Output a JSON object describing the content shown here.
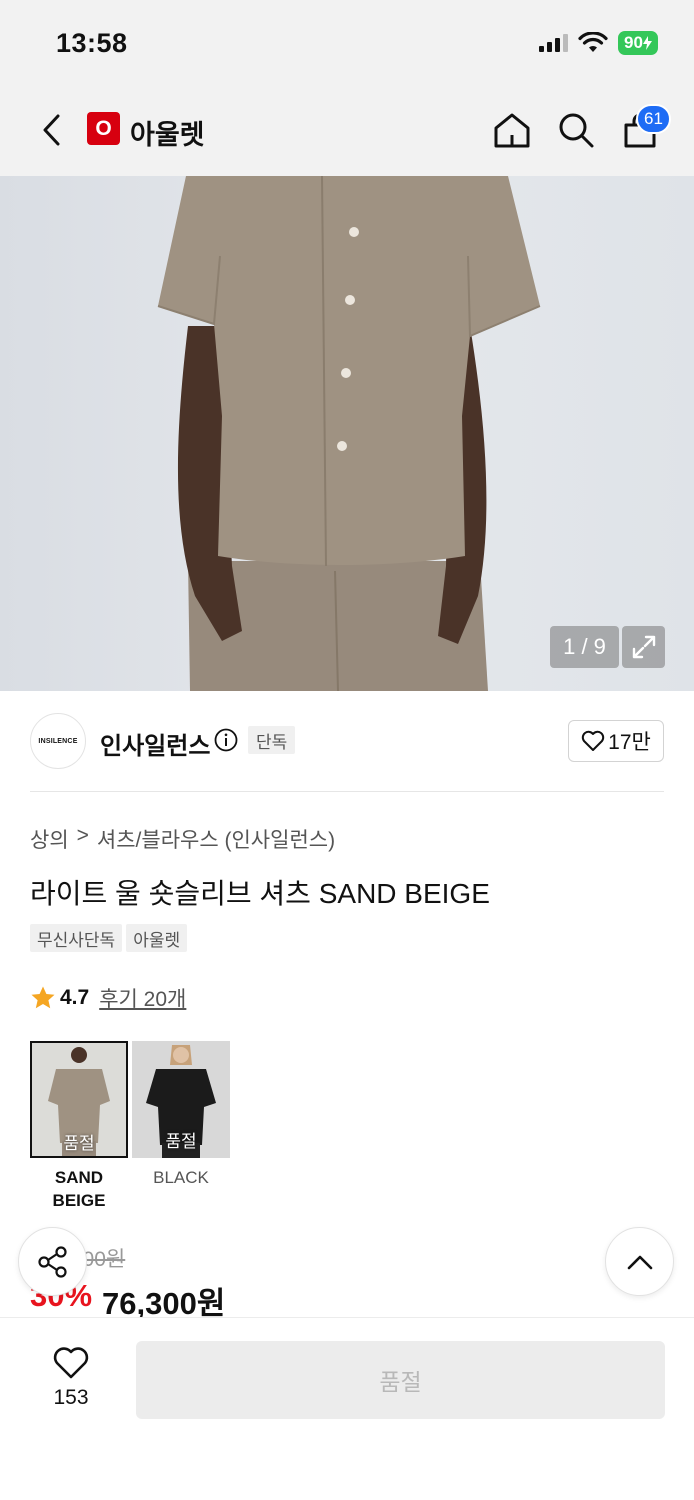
{
  "status_bar": {
    "time": "13:58",
    "battery": "90"
  },
  "nav": {
    "logo_letter": "O",
    "title": "아울렛",
    "cart_count": "61"
  },
  "gallery": {
    "counter": "1 / 9"
  },
  "brand": {
    "logo_text": "INSILENCE",
    "name": "인사일런스",
    "exclusive_tag": "단독",
    "likes": "17만"
  },
  "breadcrumb": {
    "category": "상의",
    "separator": ">",
    "subcategory": "셔츠/블라우스 (인사일런스)"
  },
  "product": {
    "title": "라이트 울 숏슬리브 셔츠 SAND BEIGE",
    "tags": [
      "무신사단독",
      "아울렛"
    ],
    "rating": "4.7",
    "review_label": "후기 20개"
  },
  "colors": [
    {
      "name_line1": "SAND",
      "name_line2": "BEIGE",
      "soldout": "품절",
      "selected": true
    },
    {
      "name_line1": "BLACK",
      "name_line2": "",
      "soldout": "품절",
      "selected": false
    }
  ],
  "price": {
    "original": "109,000원",
    "discount": "30%",
    "final": "76,300원"
  },
  "bottom_bar": {
    "wish_count": "153",
    "buy_label": "품절"
  },
  "theme": {
    "accent_red": "#e8141e",
    "badge_blue": "#1e6cf5",
    "battery_green": "#34c759",
    "star": "#f5a623"
  }
}
